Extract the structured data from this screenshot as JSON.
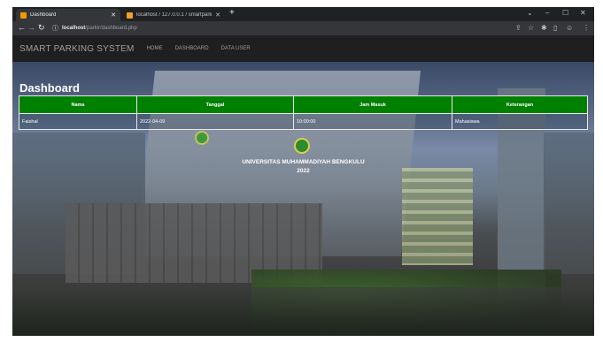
{
  "browser": {
    "tabs": [
      {
        "title": "Dashboard",
        "active": true,
        "favicon_color": "#f29900"
      },
      {
        "title": "localhost / 127.0.0.1 / smartpark",
        "active": false,
        "favicon_color": "#f0a020"
      }
    ],
    "address": {
      "host": "localhost",
      "path": "/parkir/dashboard.php"
    }
  },
  "site": {
    "brand": "SMART PARKING SYSTEM",
    "nav": [
      "HOME",
      "DASHBOARD",
      "DATA USER"
    ]
  },
  "page": {
    "heading": "Dashboard",
    "table": {
      "headers": [
        "Nama",
        "Tanggal",
        "Jam Masuk",
        "Keterangan"
      ],
      "rows": [
        [
          "Faishal",
          "2022-04-09",
          "10:00:00",
          "Mahasiswa"
        ]
      ]
    },
    "caption_line1": "UNIVERSITAS MUHAMMADIYAH BENGKULU",
    "caption_line2": "2022"
  },
  "colors": {
    "header_green": "#008000",
    "nav_bg": "#1f1f1f"
  }
}
